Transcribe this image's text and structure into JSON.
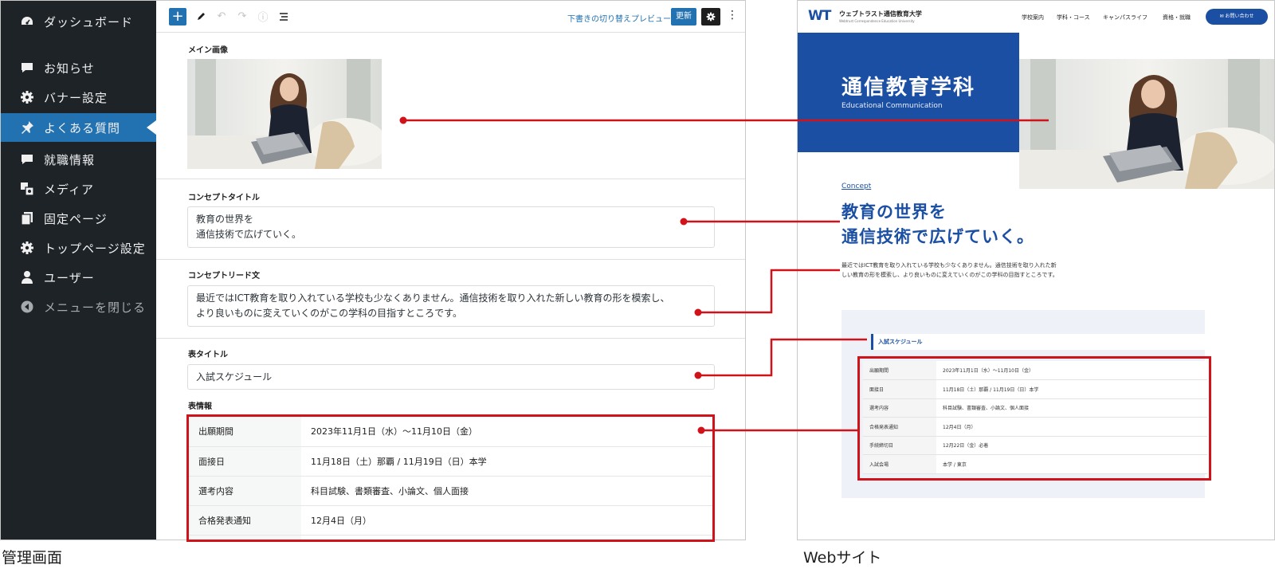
{
  "admin": {
    "caption": "管理画面",
    "sidebar": {
      "items": [
        {
          "label": "ダッシュボード",
          "icon": "dashboard-icon"
        },
        {
          "label": "お知らせ",
          "icon": "comment-icon"
        },
        {
          "label": "バナー設定",
          "icon": "gear-icon"
        },
        {
          "label": "よくある質問",
          "icon": "pin-icon",
          "active": true
        },
        {
          "label": "就職情報",
          "icon": "comment-icon"
        },
        {
          "label": "メディア",
          "icon": "media-icon"
        },
        {
          "label": "固定ページ",
          "icon": "pages-icon"
        },
        {
          "label": "トップページ設定",
          "icon": "gear-icon"
        },
        {
          "label": "ユーザー",
          "icon": "user-icon"
        },
        {
          "label": "メニューを閉じる",
          "icon": "collapse-icon"
        }
      ]
    },
    "toolbar": {
      "draft_switch": "下書きの切り替え",
      "preview": "プレビュー",
      "update": "更新"
    },
    "fields": {
      "main_image_label": "メイン画像",
      "concept_title_label": "コンセプトタイトル",
      "concept_title_line1": "教育の世界を",
      "concept_title_line2": "通信技術で広げていく。",
      "concept_lead_label": "コンセプトリード文",
      "concept_lead_line1": "最近ではICT教育を取り入れている学校も少なくありません。通信技術を取り入れた新しい教育の形を模索し、",
      "concept_lead_line2": "より良いものに変えていくのがこの学科の目指すところです。",
      "table_title_label": "表タイトル",
      "table_title_value": "入試スケジュール",
      "table_info_label": "表情報"
    },
    "table_rows": [
      {
        "key": "出願期間",
        "value": "2023年11月1日（水）〜11月10日（金）"
      },
      {
        "key": "面接日",
        "value": "11月18日（土）那覇 / 11月19日（日）本学"
      },
      {
        "key": "選考内容",
        "value": "科目試験、書類審査、小論文、個人面接"
      },
      {
        "key": "合格発表通知",
        "value": "12月4日（月）"
      }
    ]
  },
  "site": {
    "caption": "Webサイト",
    "logo_mark": "WT",
    "logo_name": "ウェブトラスト通信教育大学",
    "logo_sub": "Webtrust Correspondence Education University",
    "nav": [
      "学校案内",
      "学科・コース",
      "キャンパスライフ",
      "資格・就職"
    ],
    "contact": "お問い合わせ",
    "hero_title": "通信教育学科",
    "hero_en": "Educational Communication",
    "concept_link": "Concept",
    "concept_title_line1": "教育の世界を",
    "concept_title_line2": "通信技術で広げていく。",
    "concept_lead_line1": "最近ではICT教育を取り入れている学校も少なくありません。通信技術を取り入れた新",
    "concept_lead_line2": "しい教育の形を模索し、より良いものに変えていくのがこの学科の目指すところです。",
    "schedule_title": "入試スケジュール",
    "schedule_rows": [
      {
        "key": "出願期間",
        "value": "2023年11月1日（水）〜11月10日（金）"
      },
      {
        "key": "面接日",
        "value": "11月18日（土）那覇 / 11月19日（日）本学"
      },
      {
        "key": "選考内容",
        "value": "科目試験、書類審査、小論文、個人面接"
      },
      {
        "key": "合格発表通知",
        "value": "12月4日（月）"
      },
      {
        "key": "手続締切日",
        "value": "12月22日（金）必着"
      },
      {
        "key": "入試会場",
        "value": "本学 / 東京"
      }
    ]
  },
  "colors": {
    "admin_sidebar": "#1d2327",
    "admin_accent": "#2271b1",
    "site_brand": "#1b4fa3",
    "annotation": "#d0121b"
  }
}
